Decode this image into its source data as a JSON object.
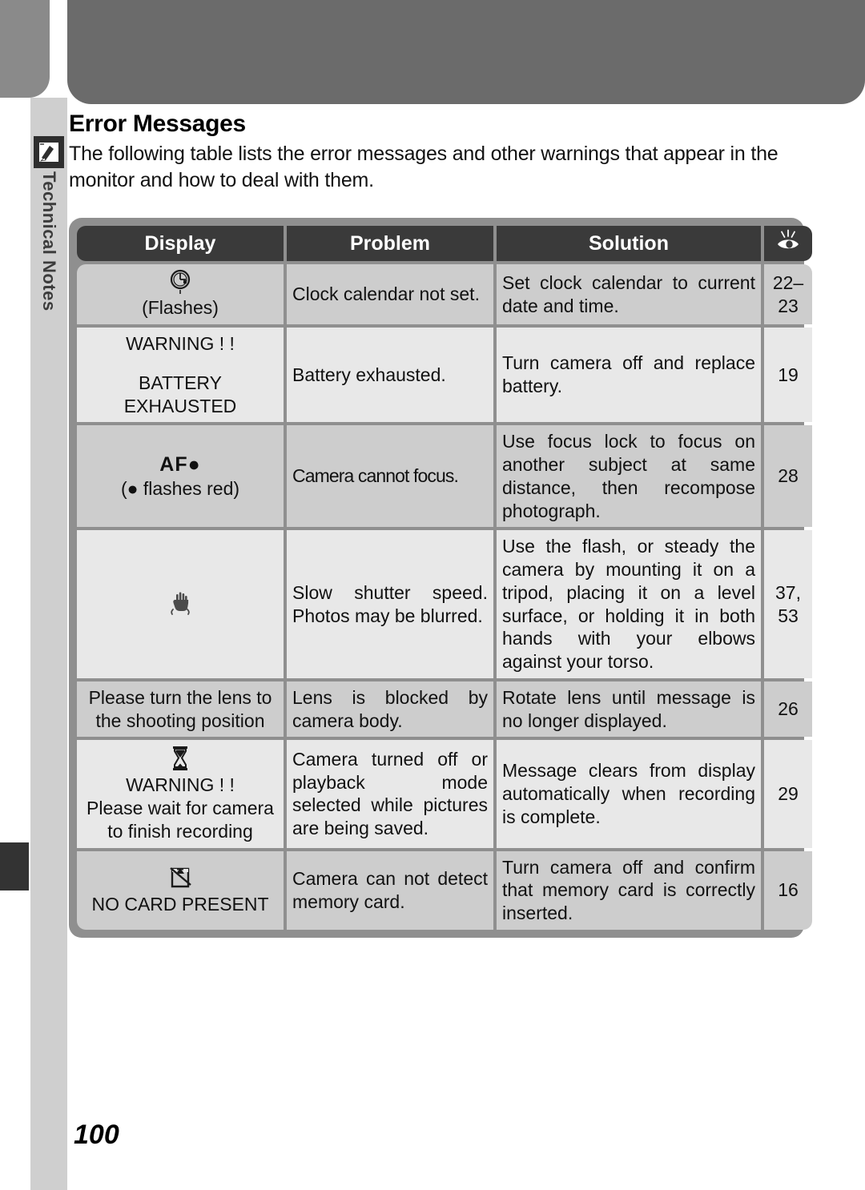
{
  "header": {
    "bar_left_color": "#8a8a8a",
    "bar_right_color": "#6b6b6b"
  },
  "sidebar": {
    "icon": "pencil-note-icon",
    "label": "Technical Notes"
  },
  "section": {
    "title": "Error Messages",
    "intro": "The following table lists the error messages and other warnings that appear in the monitor and how to deal with them."
  },
  "table": {
    "headers": {
      "display": "Display",
      "problem": "Problem",
      "solution": "Solution",
      "page": "eye-icon"
    },
    "rows": [
      {
        "display_icon": "clock-icon",
        "display_lines": [
          "(Flashes)"
        ],
        "problem": "Clock calendar not set.",
        "solution": "Set clock calendar to current date and time.",
        "page": "22–\n23"
      },
      {
        "display_icon": "",
        "display_lines": [
          "WARNING ! !",
          "",
          "BATTERY",
          "EXHAUSTED"
        ],
        "problem": "Battery exhausted.",
        "solution": "Turn camera off and replace battery.",
        "page": "19"
      },
      {
        "display_icon": "",
        "display_lines": [
          "AF●",
          "(● flashes red)"
        ],
        "problem": "Camera cannot focus.",
        "solution": "Use focus lock to focus on another subject at same distance, then recompose photograph.",
        "page": "28"
      },
      {
        "display_icon": "camera-shake-hand-icon",
        "display_lines": [],
        "problem": "Slow shutter speed. Photos may be blurred.",
        "solution": "Use the flash, or steady the camera by mounting it on a tripod, placing it on a level surface, or holding it in both hands with your elbows against your torso.",
        "page": "37,\n53"
      },
      {
        "display_icon": "",
        "display_lines": [
          "Please turn the lens to the shooting position"
        ],
        "problem": "Lens is blocked by camera body.",
        "solution": "Rotate lens until message is no longer displayed.",
        "page": "26"
      },
      {
        "display_icon": "hourglass-icon",
        "display_lines": [
          "WARNING ! !",
          "Please wait for camera to finish recording"
        ],
        "problem": "Camera turned off or playback mode selected while pictures are being saved.",
        "solution": "Message clears from display automatically when recording is complete.",
        "page": "29"
      },
      {
        "display_icon": "no-memory-card-icon",
        "display_lines": [
          "NO CARD PRESENT"
        ],
        "problem": "Camera can not detect memory card.",
        "solution": "Turn camera off and confirm that memory card is correctly inserted.",
        "page": "16"
      }
    ]
  },
  "footer": {
    "page_number": "100"
  }
}
